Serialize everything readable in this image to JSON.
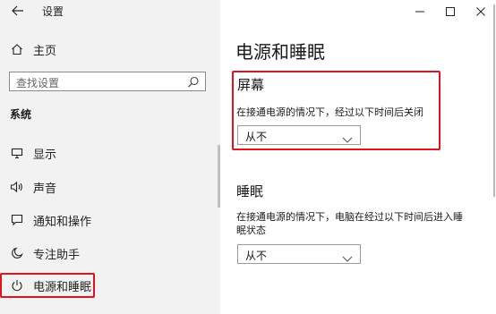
{
  "window": {
    "title": "设置"
  },
  "sidebar": {
    "home_label": "主页",
    "search_placeholder": "查找设置",
    "section_title": "系统",
    "items": [
      {
        "label": "显示",
        "icon": "monitor-icon"
      },
      {
        "label": "声音",
        "icon": "speaker-icon"
      },
      {
        "label": "通知和操作",
        "icon": "message-icon"
      },
      {
        "label": "专注助手",
        "icon": "moon-icon"
      },
      {
        "label": "电源和睡眠",
        "icon": "power-icon",
        "selected": true
      }
    ]
  },
  "main": {
    "page_title": "电源和睡眠",
    "screen": {
      "title": "屏幕",
      "description": "在接通电源的情况下，经过以下时间后关闭",
      "value": "从不"
    },
    "sleep": {
      "title": "睡眠",
      "description_line1": "在接通电源的情况下，电脑在经过以下时间后进入睡",
      "description_line2": "眠状态",
      "value": "从不"
    }
  },
  "colors": {
    "highlight_border": "#e0141e",
    "sidebar_bg": "#f2f2f2"
  }
}
